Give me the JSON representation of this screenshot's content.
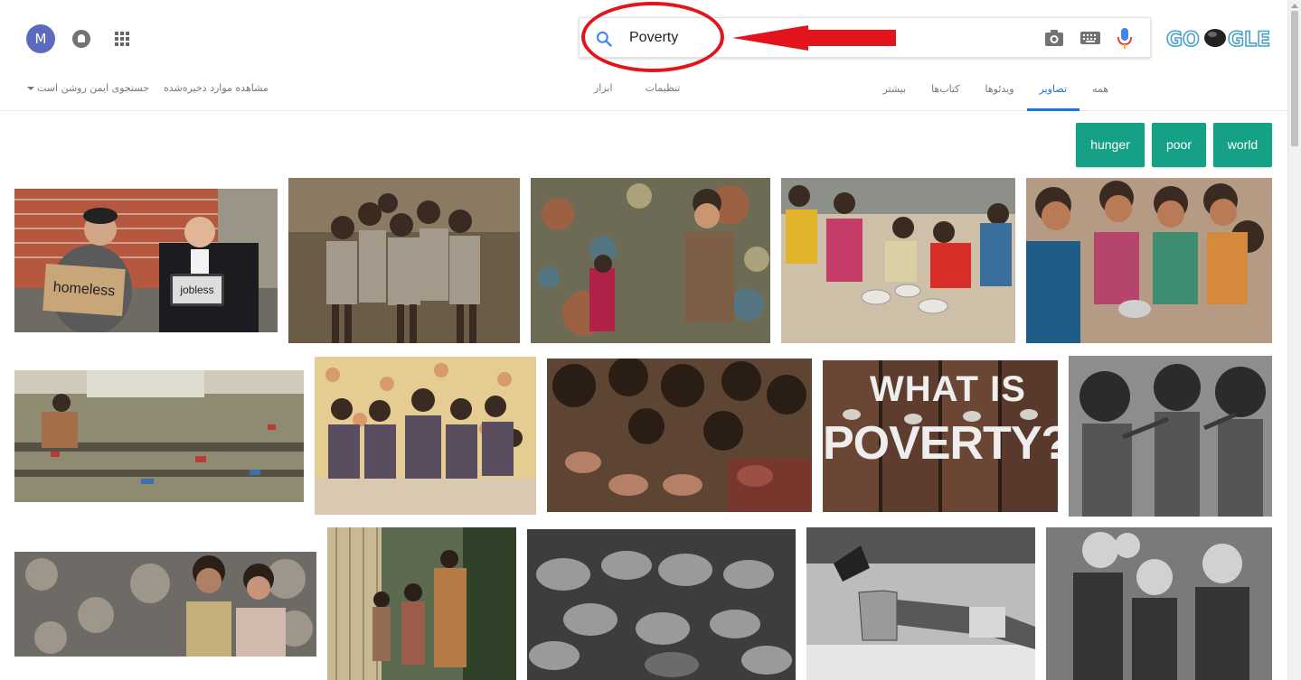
{
  "user": {
    "avatar_letter": "M"
  },
  "search": {
    "query": "Poverty"
  },
  "logo": {
    "text": "GO  GLE"
  },
  "tabs": [
    {
      "label": "همه",
      "active": false
    },
    {
      "label": "تصاویر",
      "active": true
    },
    {
      "label": "ویدئوها",
      "active": false
    },
    {
      "label": "کتاب‌ها",
      "active": false
    },
    {
      "label": "بیشتر",
      "active": false
    }
  ],
  "tools": {
    "settings": "تنظیمات",
    "tools": "ابزار"
  },
  "left_links": {
    "saved": "مشاهده موارد ذخیره‌شده",
    "safesearch": "جستجوی ایمن روشن است"
  },
  "chips": [
    "hunger",
    "poor",
    "world"
  ],
  "colors": {
    "chip": "#16a085",
    "accent": "#1a73e8",
    "annotation": "#e3141b"
  },
  "results": [
    {
      "label": "homeless / jobless",
      "caption_1": "homeless",
      "caption_2": "jobless"
    },
    {
      "label": "children group"
    },
    {
      "label": "child in garbage"
    },
    {
      "label": "children eating"
    },
    {
      "label": "children eating rice"
    },
    {
      "label": "child in garbage field"
    },
    {
      "label": "children sitting"
    },
    {
      "label": "children hands"
    },
    {
      "label": "what is poverty",
      "headline_1": "WHAT IS",
      "headline_2": "POVERTY?"
    },
    {
      "label": "bw children"
    },
    {
      "label": "children on rocks"
    },
    {
      "label": "family village"
    },
    {
      "label": "cupped hands"
    },
    {
      "label": "hand with cup"
    },
    {
      "label": "bw children group"
    }
  ]
}
